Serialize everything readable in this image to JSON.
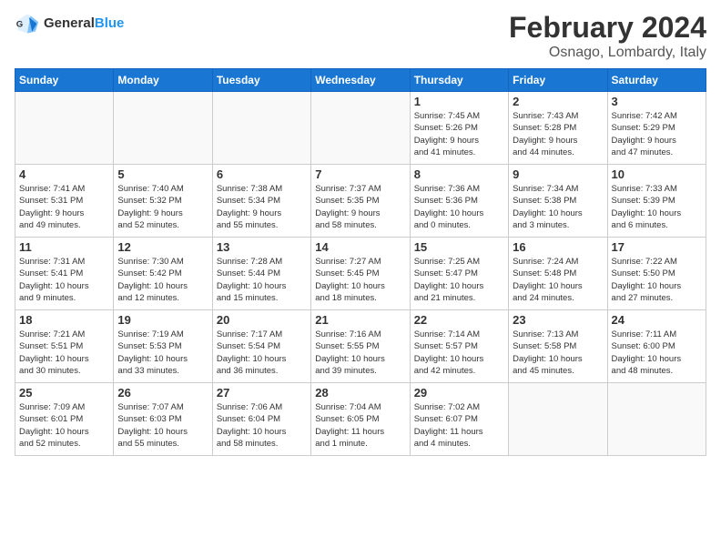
{
  "header": {
    "logo_general": "General",
    "logo_blue": "Blue",
    "main_title": "February 2024",
    "subtitle": "Osnago, Lombardy, Italy"
  },
  "days_of_week": [
    "Sunday",
    "Monday",
    "Tuesday",
    "Wednesday",
    "Thursday",
    "Friday",
    "Saturday"
  ],
  "weeks": [
    [
      {
        "num": "",
        "info": ""
      },
      {
        "num": "",
        "info": ""
      },
      {
        "num": "",
        "info": ""
      },
      {
        "num": "",
        "info": ""
      },
      {
        "num": "1",
        "info": "Sunrise: 7:45 AM\nSunset: 5:26 PM\nDaylight: 9 hours\nand 41 minutes."
      },
      {
        "num": "2",
        "info": "Sunrise: 7:43 AM\nSunset: 5:28 PM\nDaylight: 9 hours\nand 44 minutes."
      },
      {
        "num": "3",
        "info": "Sunrise: 7:42 AM\nSunset: 5:29 PM\nDaylight: 9 hours\nand 47 minutes."
      }
    ],
    [
      {
        "num": "4",
        "info": "Sunrise: 7:41 AM\nSunset: 5:31 PM\nDaylight: 9 hours\nand 49 minutes."
      },
      {
        "num": "5",
        "info": "Sunrise: 7:40 AM\nSunset: 5:32 PM\nDaylight: 9 hours\nand 52 minutes."
      },
      {
        "num": "6",
        "info": "Sunrise: 7:38 AM\nSunset: 5:34 PM\nDaylight: 9 hours\nand 55 minutes."
      },
      {
        "num": "7",
        "info": "Sunrise: 7:37 AM\nSunset: 5:35 PM\nDaylight: 9 hours\nand 58 minutes."
      },
      {
        "num": "8",
        "info": "Sunrise: 7:36 AM\nSunset: 5:36 PM\nDaylight: 10 hours\nand 0 minutes."
      },
      {
        "num": "9",
        "info": "Sunrise: 7:34 AM\nSunset: 5:38 PM\nDaylight: 10 hours\nand 3 minutes."
      },
      {
        "num": "10",
        "info": "Sunrise: 7:33 AM\nSunset: 5:39 PM\nDaylight: 10 hours\nand 6 minutes."
      }
    ],
    [
      {
        "num": "11",
        "info": "Sunrise: 7:31 AM\nSunset: 5:41 PM\nDaylight: 10 hours\nand 9 minutes."
      },
      {
        "num": "12",
        "info": "Sunrise: 7:30 AM\nSunset: 5:42 PM\nDaylight: 10 hours\nand 12 minutes."
      },
      {
        "num": "13",
        "info": "Sunrise: 7:28 AM\nSunset: 5:44 PM\nDaylight: 10 hours\nand 15 minutes."
      },
      {
        "num": "14",
        "info": "Sunrise: 7:27 AM\nSunset: 5:45 PM\nDaylight: 10 hours\nand 18 minutes."
      },
      {
        "num": "15",
        "info": "Sunrise: 7:25 AM\nSunset: 5:47 PM\nDaylight: 10 hours\nand 21 minutes."
      },
      {
        "num": "16",
        "info": "Sunrise: 7:24 AM\nSunset: 5:48 PM\nDaylight: 10 hours\nand 24 minutes."
      },
      {
        "num": "17",
        "info": "Sunrise: 7:22 AM\nSunset: 5:50 PM\nDaylight: 10 hours\nand 27 minutes."
      }
    ],
    [
      {
        "num": "18",
        "info": "Sunrise: 7:21 AM\nSunset: 5:51 PM\nDaylight: 10 hours\nand 30 minutes."
      },
      {
        "num": "19",
        "info": "Sunrise: 7:19 AM\nSunset: 5:53 PM\nDaylight: 10 hours\nand 33 minutes."
      },
      {
        "num": "20",
        "info": "Sunrise: 7:17 AM\nSunset: 5:54 PM\nDaylight: 10 hours\nand 36 minutes."
      },
      {
        "num": "21",
        "info": "Sunrise: 7:16 AM\nSunset: 5:55 PM\nDaylight: 10 hours\nand 39 minutes."
      },
      {
        "num": "22",
        "info": "Sunrise: 7:14 AM\nSunset: 5:57 PM\nDaylight: 10 hours\nand 42 minutes."
      },
      {
        "num": "23",
        "info": "Sunrise: 7:13 AM\nSunset: 5:58 PM\nDaylight: 10 hours\nand 45 minutes."
      },
      {
        "num": "24",
        "info": "Sunrise: 7:11 AM\nSunset: 6:00 PM\nDaylight: 10 hours\nand 48 minutes."
      }
    ],
    [
      {
        "num": "25",
        "info": "Sunrise: 7:09 AM\nSunset: 6:01 PM\nDaylight: 10 hours\nand 52 minutes."
      },
      {
        "num": "26",
        "info": "Sunrise: 7:07 AM\nSunset: 6:03 PM\nDaylight: 10 hours\nand 55 minutes."
      },
      {
        "num": "27",
        "info": "Sunrise: 7:06 AM\nSunset: 6:04 PM\nDaylight: 10 hours\nand 58 minutes."
      },
      {
        "num": "28",
        "info": "Sunrise: 7:04 AM\nSunset: 6:05 PM\nDaylight: 11 hours\nand 1 minute."
      },
      {
        "num": "29",
        "info": "Sunrise: 7:02 AM\nSunset: 6:07 PM\nDaylight: 11 hours\nand 4 minutes."
      },
      {
        "num": "",
        "info": ""
      },
      {
        "num": "",
        "info": ""
      }
    ]
  ]
}
